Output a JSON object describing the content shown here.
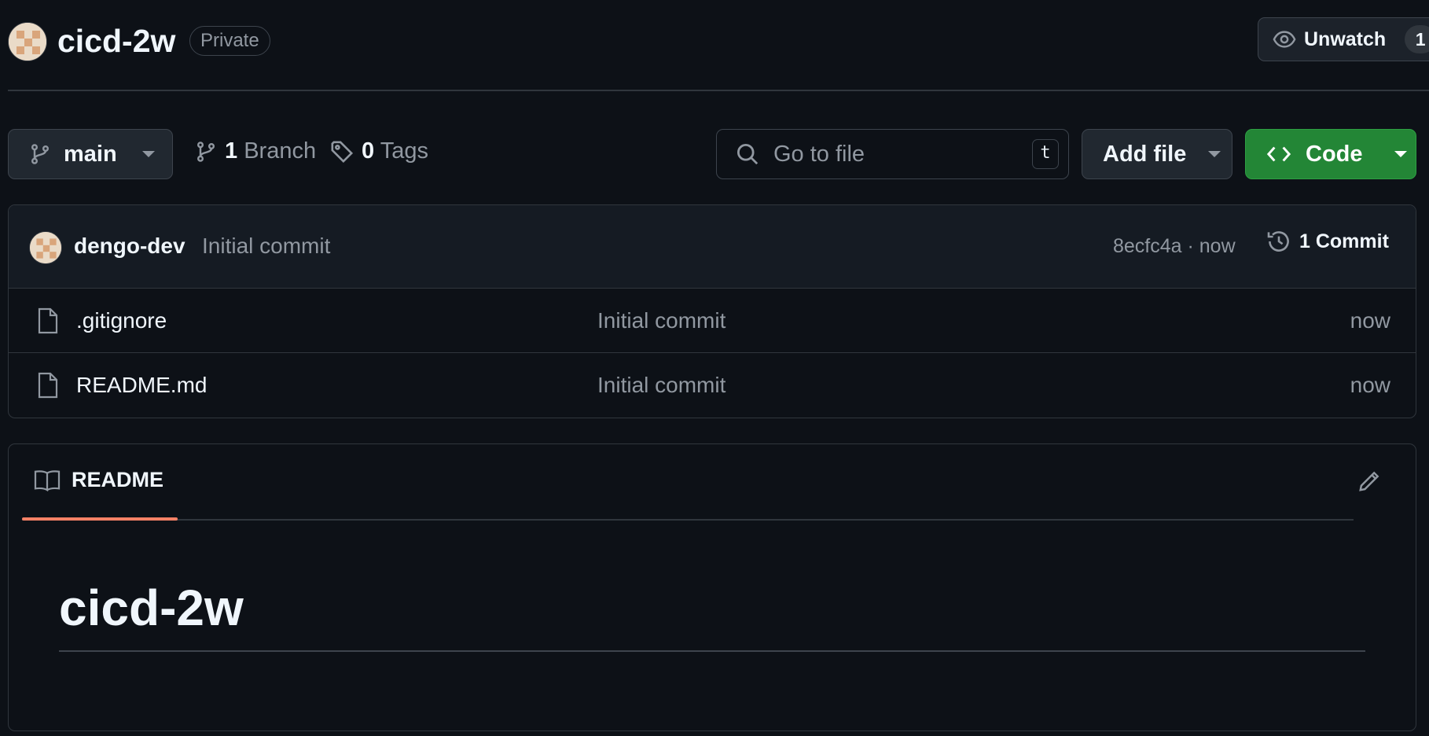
{
  "repo": {
    "name": "cicd-2w",
    "visibility": "Private"
  },
  "watch": {
    "label": "Unwatch",
    "count": "1",
    "icon": "eye-icon"
  },
  "toolbar": {
    "branch_label": "main",
    "branch_count": "1",
    "branch_word": "Branch",
    "tag_count": "0",
    "tag_word": "Tags",
    "search_placeholder": "Go to file",
    "search_shortcut": "t",
    "add_file_label": "Add file",
    "code_label": "Code"
  },
  "latest_commit": {
    "author": "dengo-dev",
    "message": "Initial commit",
    "meta": "8ecfc4a · now",
    "commits_label": "1 Commit"
  },
  "files": [
    {
      "name": ".gitignore",
      "commit": "Initial commit",
      "age": "now"
    },
    {
      "name": "README.md",
      "commit": "Initial commit",
      "age": "now"
    }
  ],
  "readme": {
    "tab_label": "README",
    "heading": "cicd-2w"
  },
  "colors": {
    "background": "#0d1117",
    "code_button": "#238636",
    "tab_underline": "#f78166",
    "muted_text": "#9198a1",
    "border": "#30363d"
  }
}
